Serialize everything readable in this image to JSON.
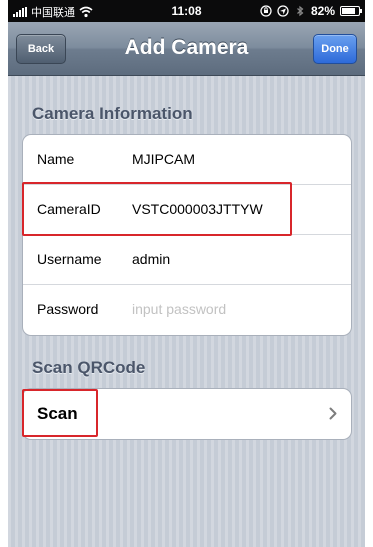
{
  "statusbar": {
    "carrier": "中国联通",
    "time": "11:08",
    "battery": "82%",
    "battery_level": 0.82,
    "icons": [
      "signal-icon",
      "wifi-icon",
      "lock-rotation-icon",
      "location-icon",
      "bluetooth-icon",
      "battery-icon"
    ]
  },
  "navbar": {
    "title": "Add Camera",
    "back_label": "Back",
    "done_label": "Done"
  },
  "camera_info": {
    "header": "Camera Information",
    "rows": [
      {
        "label": "Name",
        "value": "MJIPCAM"
      },
      {
        "label": "CameraID",
        "value": "VSTC000003JTTYW"
      },
      {
        "label": "Username",
        "value": "admin"
      },
      {
        "label": "Password",
        "placeholder": "input password"
      }
    ]
  },
  "scan": {
    "header": "Scan QRCode",
    "label": "Scan"
  },
  "colors": {
    "background": "#c5ccd6",
    "navbar": "#7d8c9d",
    "done_button": "#2d6ad9",
    "highlight": "#d8262b",
    "section_header": "#4b566a"
  }
}
